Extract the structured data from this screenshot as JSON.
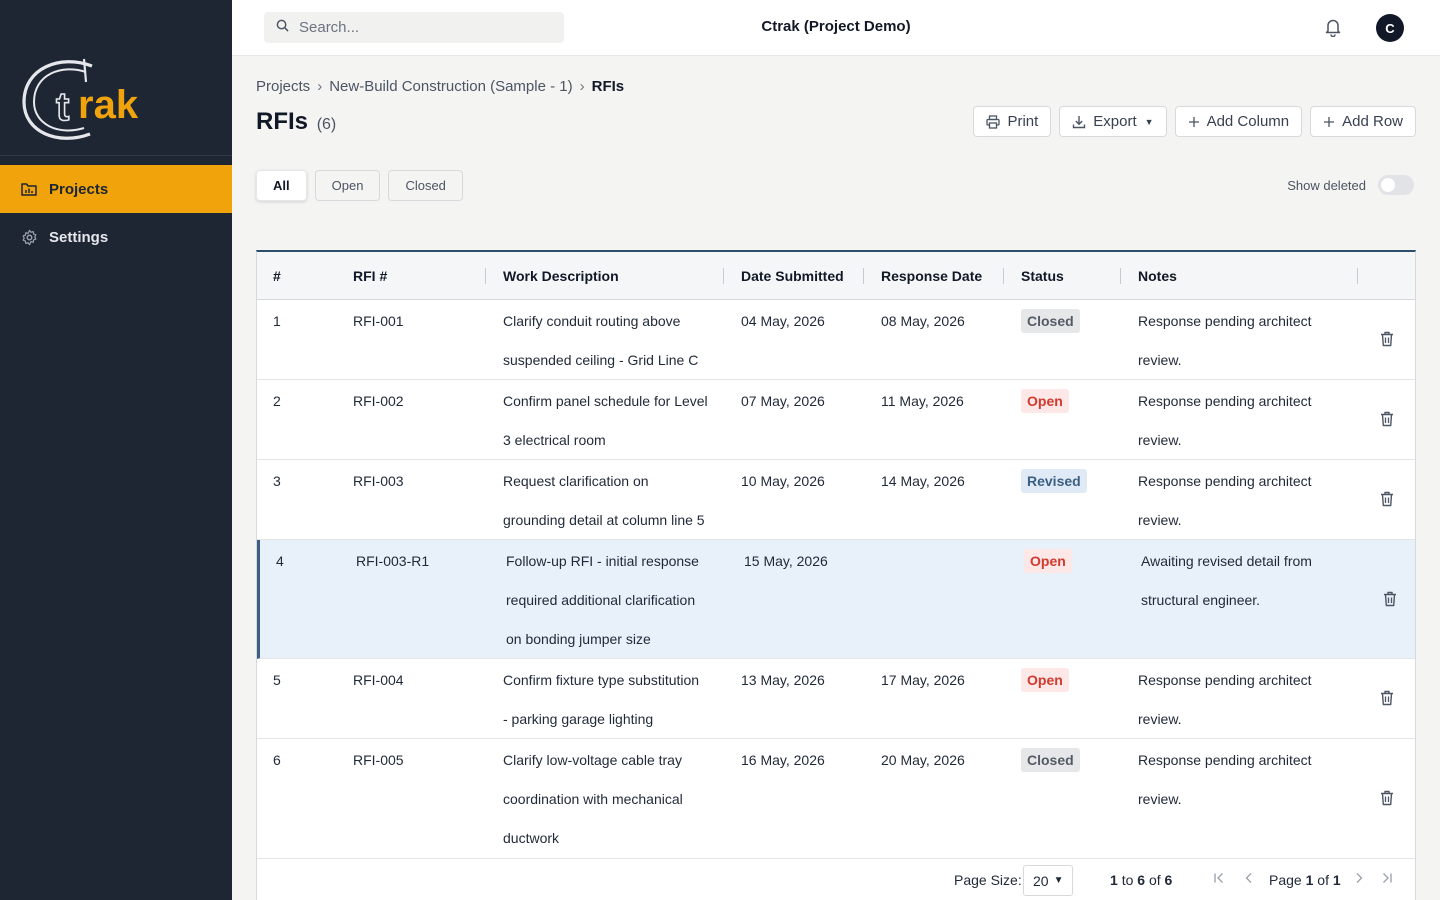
{
  "app": {
    "title": "Ctrak (Project Demo)",
    "logo_text": "ctrak",
    "user_initial": "C"
  },
  "search": {
    "placeholder": "Search..."
  },
  "sidebar": {
    "items": [
      {
        "label": "Projects",
        "icon": "folder-chart-icon",
        "active": true
      },
      {
        "label": "Settings",
        "icon": "gear-icon",
        "active": false
      }
    ]
  },
  "breadcrumb": {
    "items": [
      "Projects",
      "New-Build Construction (Sample - 1)",
      "RFIs"
    ]
  },
  "page": {
    "title": "RFIs",
    "count": "(6)"
  },
  "toolbar": {
    "print": "Print",
    "export": "Export",
    "add_column": "Add Column",
    "add_row": "Add Row"
  },
  "filters": {
    "tabs": [
      "All",
      "Open",
      "Closed"
    ],
    "active": "All",
    "show_deleted": "Show deleted",
    "show_deleted_on": false
  },
  "table": {
    "columns": [
      "#",
      "RFI #",
      "Work Description",
      "Date Submitted",
      "Response Date",
      "Status",
      "Notes"
    ],
    "rows": [
      {
        "num": "1",
        "rfi": "RFI-001",
        "desc": [
          "Clarify conduit routing above",
          "suspended ceiling - Grid Line C"
        ],
        "submitted": "04 May, 2026",
        "response": "08 May, 2026",
        "status": "Closed",
        "notes": [
          "Response pending architect",
          "review."
        ]
      },
      {
        "num": "2",
        "rfi": "RFI-002",
        "desc": [
          "Confirm panel schedule for Level",
          "3 electrical room"
        ],
        "submitted": "07 May, 2026",
        "response": "11 May, 2026",
        "status": "Open",
        "notes": [
          "Response pending architect",
          "review."
        ]
      },
      {
        "num": "3",
        "rfi": "RFI-003",
        "desc": [
          "Request clarification on",
          "grounding detail at column line 5"
        ],
        "submitted": "10 May, 2026",
        "response": "14 May, 2026",
        "status": "Revised",
        "notes": [
          "Response pending architect",
          "review."
        ]
      },
      {
        "num": "4",
        "rfi": "RFI-003-R1",
        "desc": [
          "Follow-up RFI - initial response",
          "required additional clarification",
          "on bonding jumper size"
        ],
        "submitted": "15 May, 2026",
        "response": "",
        "status": "Open",
        "notes": [
          "Awaiting revised detail from",
          "structural engineer."
        ]
      },
      {
        "num": "5",
        "rfi": "RFI-004",
        "desc": [
          "Confirm fixture type substitution",
          "- parking garage lighting"
        ],
        "submitted": "13 May, 2026",
        "response": "17 May, 2026",
        "status": "Open",
        "notes": [
          "Response pending architect",
          "review."
        ]
      },
      {
        "num": "6",
        "rfi": "RFI-005",
        "desc": [
          "Clarify low-voltage cable tray",
          "coordination with mechanical",
          "ductwork"
        ],
        "submitted": "16 May, 2026",
        "response": "20 May, 2026",
        "status": "Closed",
        "notes": [
          "Response pending architect",
          "review."
        ]
      }
    ]
  },
  "pagination": {
    "page_size_label": "Page Size:",
    "page_size": "20",
    "range_from": "1",
    "range_to": "6",
    "total": "6",
    "to_text": "to",
    "of_text": "of",
    "page_label": "Page",
    "page": "1",
    "page_count": "1"
  },
  "colors": {
    "sidebar_bg": "#1e2533",
    "accent": "#f0a30a",
    "closed_badge": "#555b66",
    "open_badge": "#d13a2d",
    "revised_badge": "#3d5f84"
  }
}
